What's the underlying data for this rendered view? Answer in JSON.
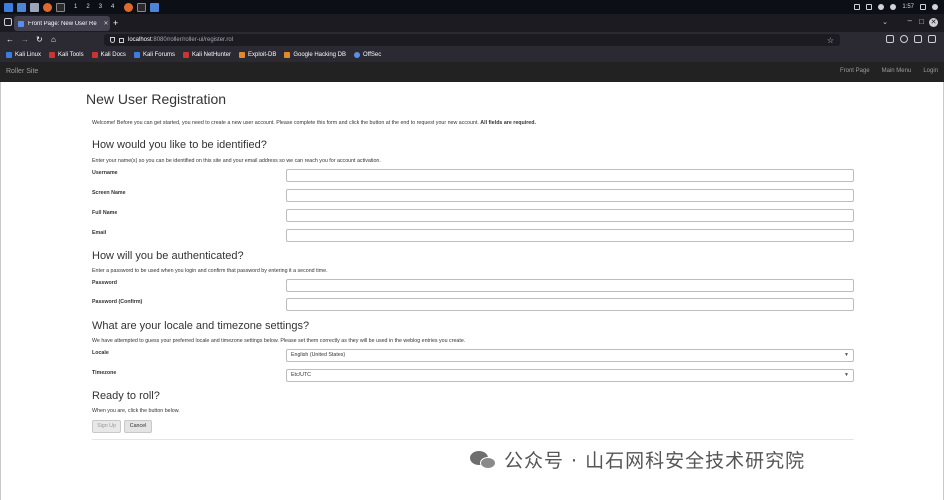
{
  "taskbar": {
    "workspaces": [
      "1",
      "2",
      "3",
      "4"
    ],
    "time": "1:57"
  },
  "browser": {
    "tab_title": "Front Page: New User Re",
    "url_host": "localhost",
    "url_path": ":8080/roller/roller-ui/register.rol",
    "bookmarks": [
      "Kali Linux",
      "Kali Tools",
      "Kali Docs",
      "Kali Forums",
      "Kali NetHunter",
      "Exploit-DB",
      "Google Hacking DB",
      "OffSec"
    ]
  },
  "site": {
    "brand": "Roller Site",
    "nav": [
      "Front Page",
      "Main Menu",
      "Login"
    ]
  },
  "page": {
    "title": "New User Registration",
    "intro": "Welcome! Before you can get started, you need to create a new user account. Please complete this form and click the button at the end to request your new account.",
    "intro_bold": "All fields are required.",
    "sections": {
      "identity": {
        "heading": "How would you like to be identified?",
        "desc": "Enter your name(s) so you can be identified on this site and your email address so we can reach you for account activation.",
        "fields": [
          "Username",
          "Screen Name",
          "Full Name",
          "Email"
        ]
      },
      "auth": {
        "heading": "How will you be authenticated?",
        "desc": "Enter a password to be used when you login and confirm that password by entering it a second time.",
        "fields": [
          "Password",
          "Password (Confirm)"
        ]
      },
      "locale": {
        "heading": "What are your locale and timezone settings?",
        "desc": "We have attempted to guess your preferred locale and timezone settings below. Please set them correctly as they will be used in the weblog entries you create.",
        "locale_label": "Locale",
        "locale_value": "English (United States)",
        "timezone_label": "Timezone",
        "timezone_value": "Etc/UTC"
      },
      "ready": {
        "heading": "Ready to roll?",
        "desc": "When you are, click the button below.",
        "signup": "Sign Up",
        "cancel": "Cancel"
      }
    }
  },
  "watermark": "公众号 · 山石网科安全技术研究院"
}
